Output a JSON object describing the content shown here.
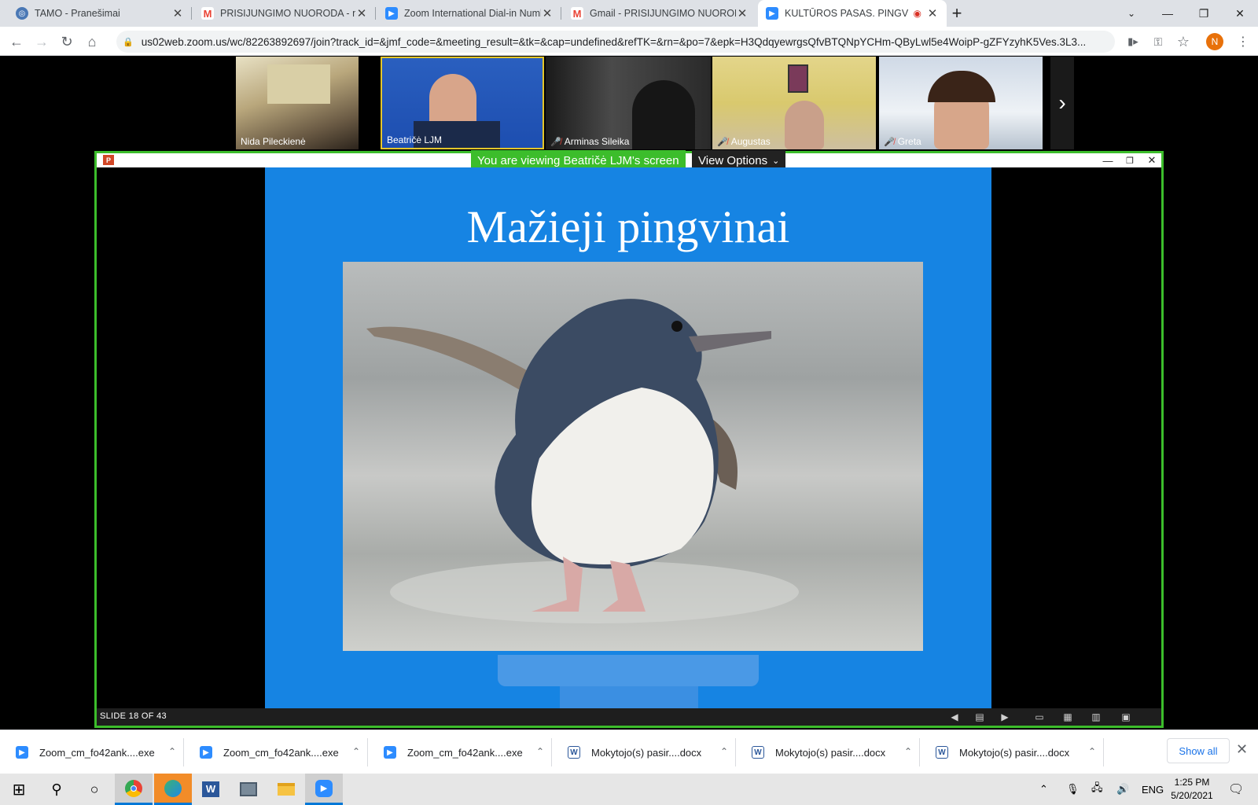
{
  "browser": {
    "tabs": [
      {
        "title": "TAMO - Pranešimai",
        "icon": "tamo-icon",
        "color": "#4a78b5"
      },
      {
        "title": "PRISIJUNGIMO NUORODA - npil",
        "icon": "gmail-icon",
        "color": "#ea4335"
      },
      {
        "title": "Zoom International Dial-in Numb",
        "icon": "zoom-icon",
        "color": "#2d8cff"
      },
      {
        "title": "Gmail - PRISIJUNGIMO NUOROD",
        "icon": "gmail-icon",
        "color": "#ea4335"
      },
      {
        "title": "KULTŪROS PASAS. PINGVINA",
        "icon": "zoom-icon",
        "color": "#2d8cff",
        "recording": true
      }
    ],
    "new_tab": "+",
    "window_buttons": {
      "minimize": "—",
      "restore": "❐",
      "close": "✕"
    },
    "address": "us02web.zoom.us/wc/82263892697/join?track_id=&jmf_code=&meeting_result=&tk=&cap=undefined&refTK=&rn=&po=7&epk=H3QdqyewrgsQfvBTQNpYCHm-QByLwl5e4WoipP-gZFYzyhK5Ves.3L3...",
    "profile_initial": "N",
    "profile_color": "#e8710a"
  },
  "zoom": {
    "participants": [
      {
        "name": "Nida Pileckienė",
        "muted": false
      },
      {
        "name": "Beatričė LJM",
        "muted": false,
        "active_speaker": true
      },
      {
        "name": "Arminas Sileika",
        "muted": true
      },
      {
        "name": "Augustas",
        "muted": true
      },
      {
        "name": "Greta",
        "muted": true
      }
    ],
    "viewing_banner": "You are viewing Beatričė LJM's screen",
    "view_options": "View Options",
    "accent_green": "#3cbd2b",
    "slide": {
      "title": "Mažieji pingvinai",
      "counter": "SLIDE 18 OF 43",
      "bg_color": "#1684e3"
    }
  },
  "downloads": {
    "items": [
      {
        "name": "Zoom_cm_fo42ank....exe",
        "icon": "zoom-icon"
      },
      {
        "name": "Zoom_cm_fo42ank....exe",
        "icon": "zoom-icon"
      },
      {
        "name": "Zoom_cm_fo42ank....exe",
        "icon": "zoom-icon"
      },
      {
        "name": "Mokytojo(s) pasir....docx",
        "icon": "word-icon"
      },
      {
        "name": "Mokytojo(s) pasir....docx",
        "icon": "word-icon"
      },
      {
        "name": "Mokytojo(s) pasir....docx",
        "icon": "word-icon"
      }
    ],
    "show_all": "Show all"
  },
  "taskbar": {
    "language": "ENG",
    "time": "1:25 PM",
    "date": "5/20/2021"
  }
}
